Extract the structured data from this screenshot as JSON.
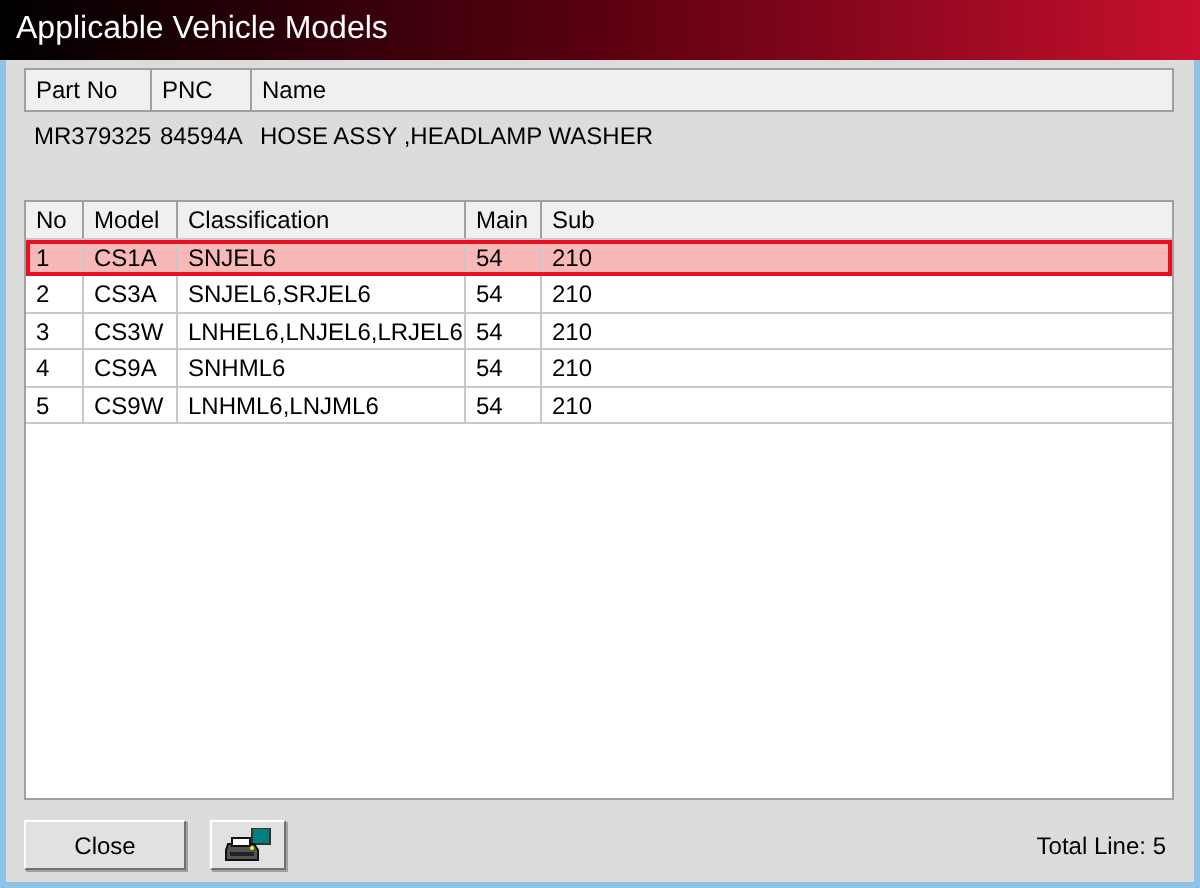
{
  "window": {
    "title": "Applicable Vehicle Models"
  },
  "part": {
    "columns": [
      "Part No",
      "PNC",
      "Name"
    ],
    "values": [
      "MR379325",
      "84594A",
      "HOSE ASSY ,HEADLAMP WASHER"
    ]
  },
  "table": {
    "columns": [
      "No",
      "Model",
      "Classification",
      "Main",
      "Sub"
    ],
    "rows": [
      {
        "cells": [
          "1",
          "CS1A",
          "SNJEL6",
          "54",
          "210"
        ],
        "selected": true
      },
      {
        "cells": [
          "2",
          "CS3A",
          "SNJEL6,SRJEL6",
          "54",
          "210"
        ],
        "selected": false
      },
      {
        "cells": [
          "3",
          "CS3W",
          "LNHEL6,LNJEL6,LRJEL6",
          "54",
          "210"
        ],
        "selected": false
      },
      {
        "cells": [
          "4",
          "CS9A",
          "SNHML6",
          "54",
          "210"
        ],
        "selected": false
      },
      {
        "cells": [
          "5",
          "CS9W",
          "LNHML6,LNJML6",
          "54",
          "210"
        ],
        "selected": false
      }
    ]
  },
  "buttons": {
    "close": "Close"
  },
  "status": "Total Line: 5"
}
